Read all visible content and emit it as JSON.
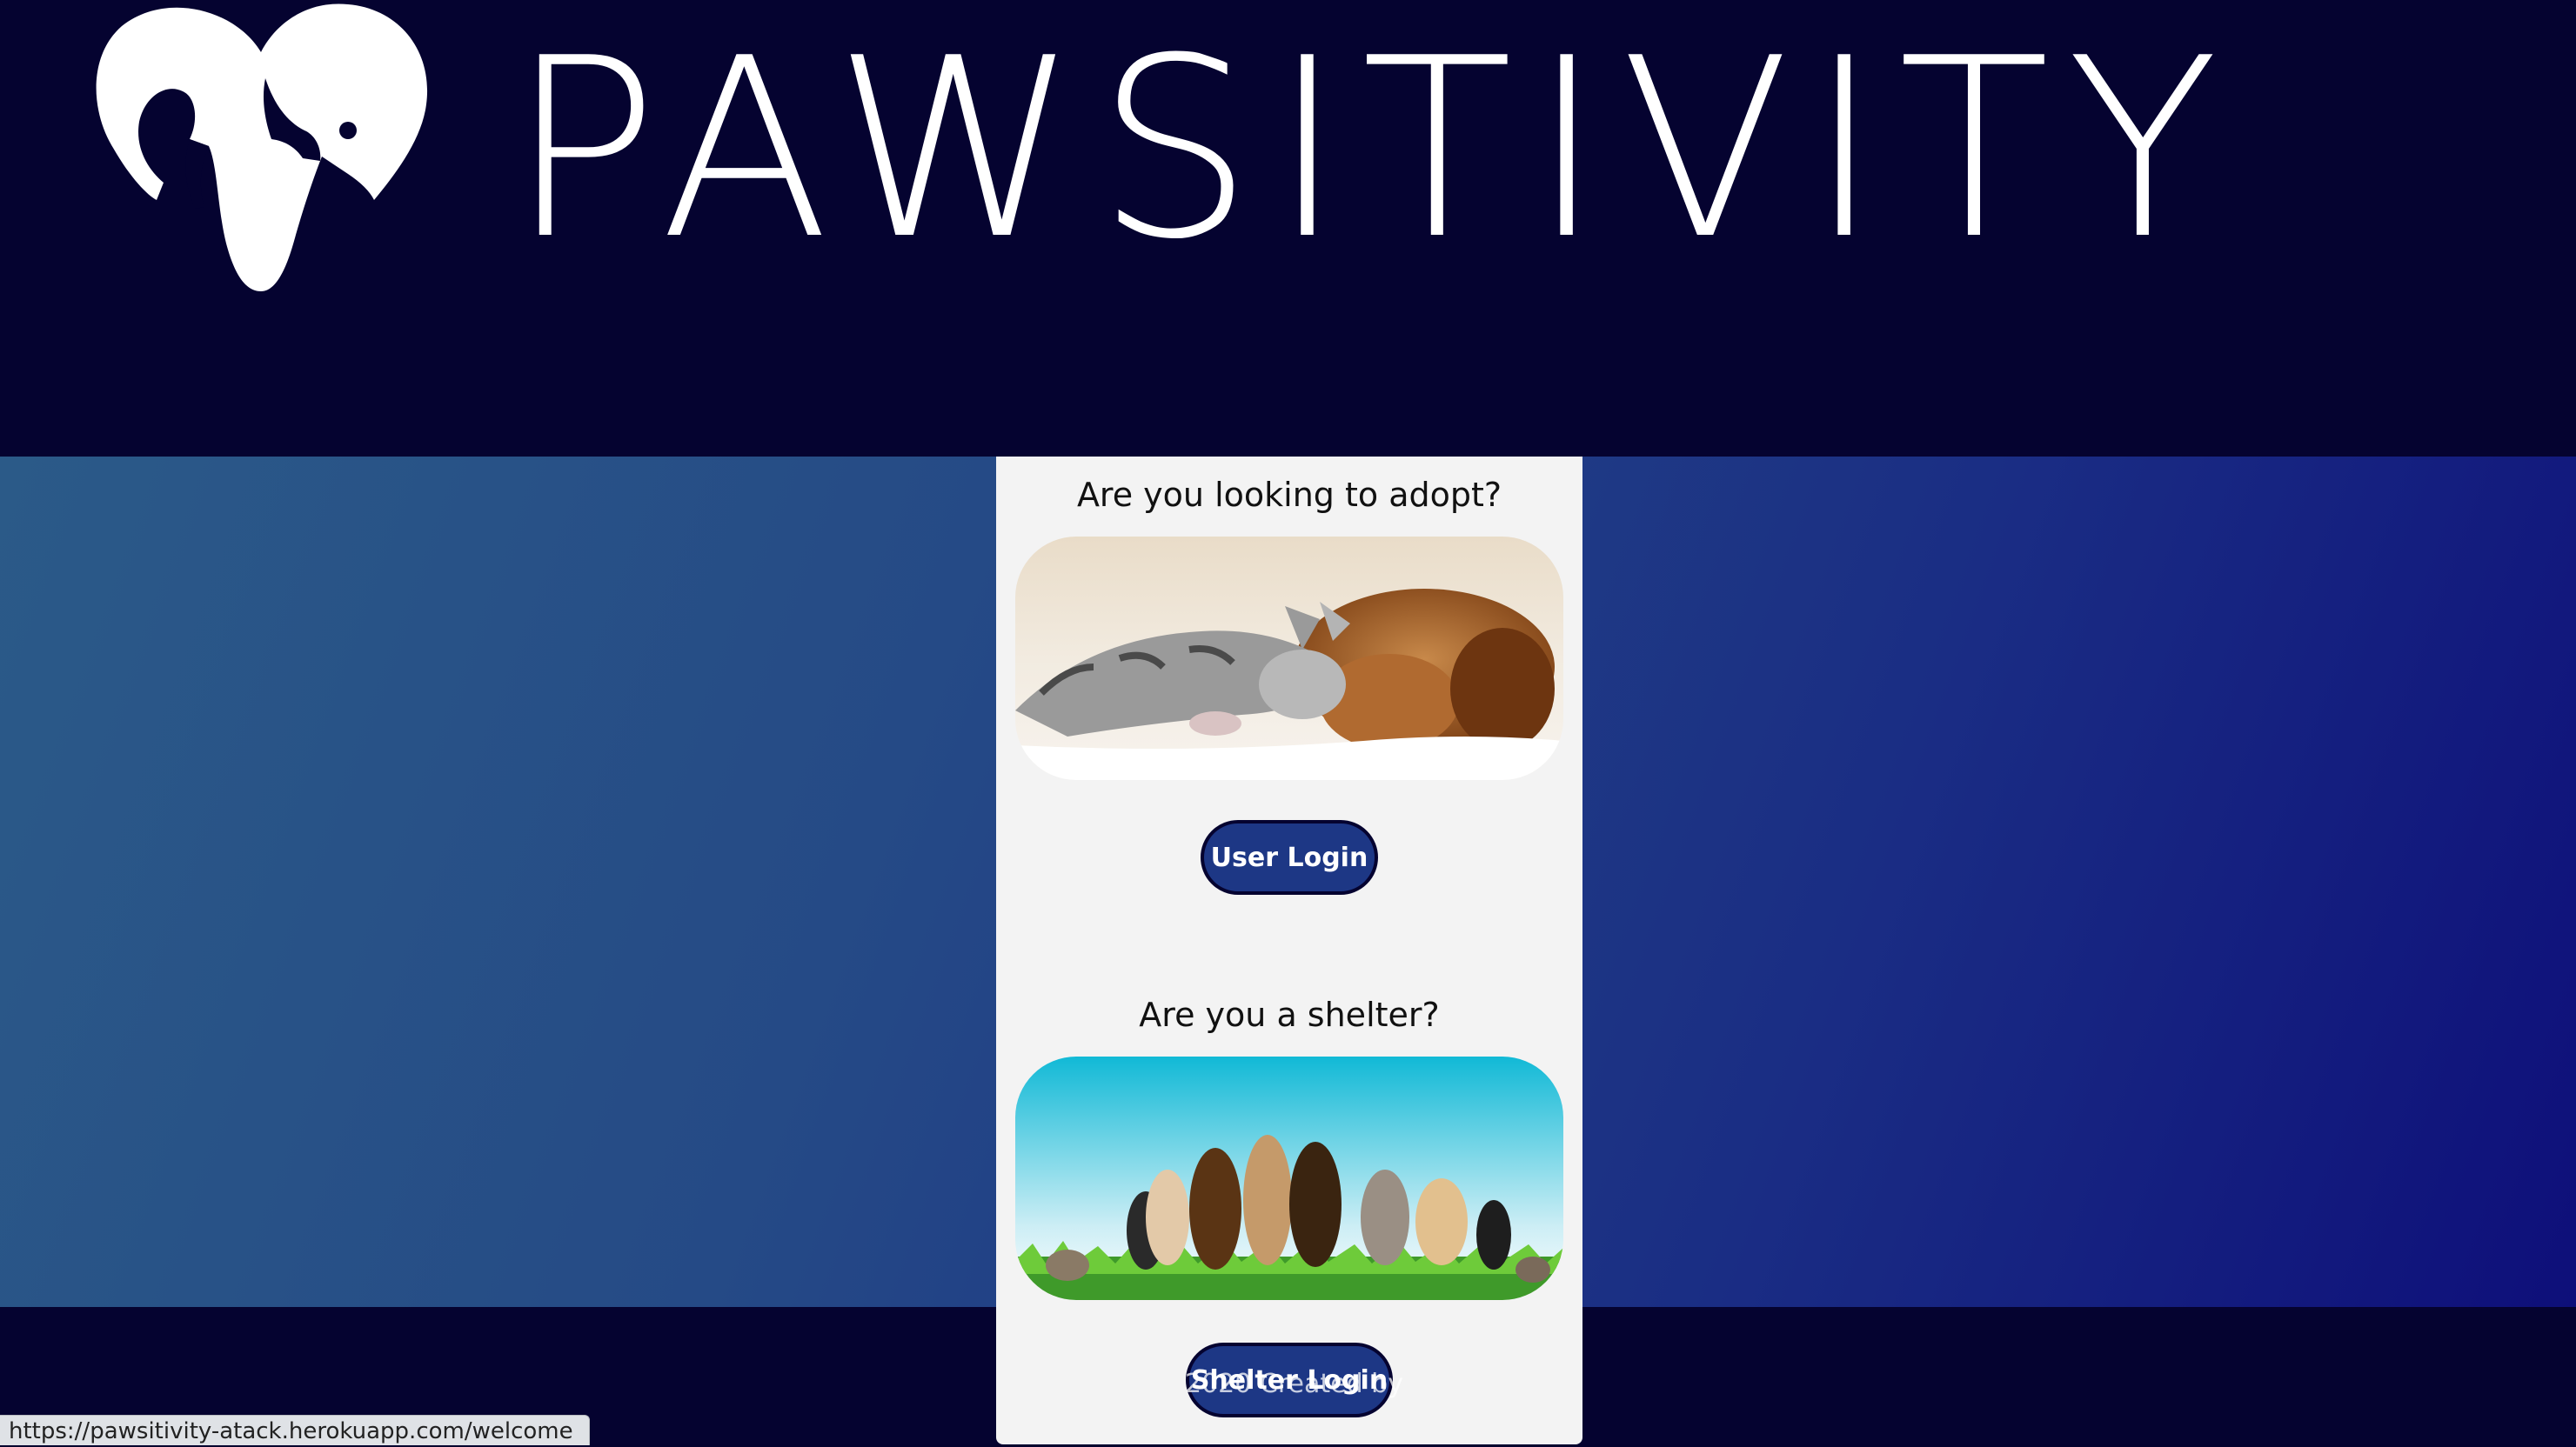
{
  "brand": {
    "name": "PAWSITIVITY"
  },
  "adopt": {
    "question": "Are you looking to adopt?",
    "button_label": "User Login"
  },
  "shelter": {
    "question": "Are you a shelter?",
    "button_label": "Shelter Login"
  },
  "footer": {
    "copyright": "2020 Created by"
  },
  "status_bar": {
    "url": "https://pawsitivity-atack.herokuapp.com/welcome"
  },
  "colors": {
    "header_bg": "#050330",
    "button_bg": "#1d3785",
    "card_bg": "#f3f3f3",
    "gradient_left": "#2b5a88",
    "gradient_right": "#0e0f7a"
  },
  "icons": [
    "dog-cat-heart-logo-icon"
  ]
}
